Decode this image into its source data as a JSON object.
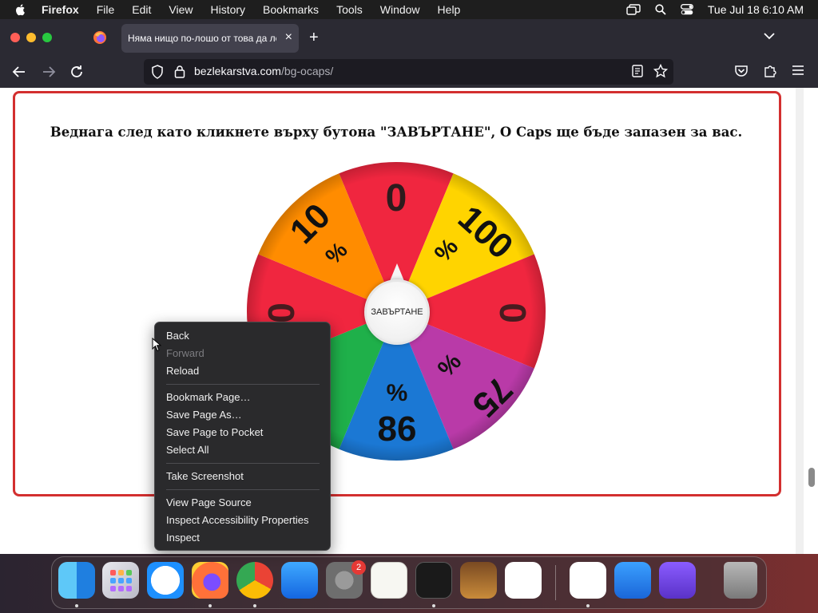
{
  "menubar": {
    "app_name": "Firefox",
    "items": [
      "File",
      "Edit",
      "View",
      "History",
      "Bookmarks",
      "Tools",
      "Window",
      "Help"
    ],
    "clock": "Tue Jul 18  6:10 AM"
  },
  "browser": {
    "tab_title": "Няма нищо по-лошо от това да ле",
    "new_tab_symbol": "+",
    "tab_close_symbol": "×",
    "url_domain": "bezlekarstva.com",
    "url_path": "/bg-ocaps/"
  },
  "page": {
    "headline": "Веднага след като кликнете върху бутона \"ЗАВЪРТАНЕ\", O Caps ще бъде запазен за вас.",
    "spin_button_label": "ЗАВЪРТАНЕ",
    "wheel_segments": [
      {
        "label": "0",
        "color": "#f0263f"
      },
      {
        "label": "100 %",
        "color": "#ffd400"
      },
      {
        "label": "0",
        "color": "#f0263f"
      },
      {
        "label": "75 %",
        "color": "#b93aa8"
      },
      {
        "label": "86 %",
        "color": "#1b78d4"
      },
      {
        "label": "%",
        "color": "#1fb04a"
      },
      {
        "label": "0",
        "color": "#f0263f"
      },
      {
        "label": "10 %",
        "color": "#ff8c00"
      }
    ]
  },
  "context_menu": {
    "back": "Back",
    "forward": "Forward",
    "reload": "Reload",
    "bookmark": "Bookmark Page…",
    "save_as": "Save Page As…",
    "save_pocket": "Save Page to Pocket",
    "select_all": "Select All",
    "screenshot": "Take Screenshot",
    "view_source": "View Page Source",
    "inspect_a11y": "Inspect Accessibility Properties",
    "inspect": "Inspect"
  },
  "dock": {
    "apps": [
      "Finder",
      "Launchpad",
      "Safari",
      "Firefox",
      "Chrome",
      "App Store",
      "System Settings",
      "TextEdit",
      "Terminal",
      "Instruments",
      "Visual Studio Code",
      "Visual Studio",
      "Weather",
      "Simulator",
      "Trash"
    ],
    "settings_badge": "2"
  },
  "colors": {
    "promo_border": "#d32f2f",
    "menu_bg": "#2a2a2c"
  }
}
